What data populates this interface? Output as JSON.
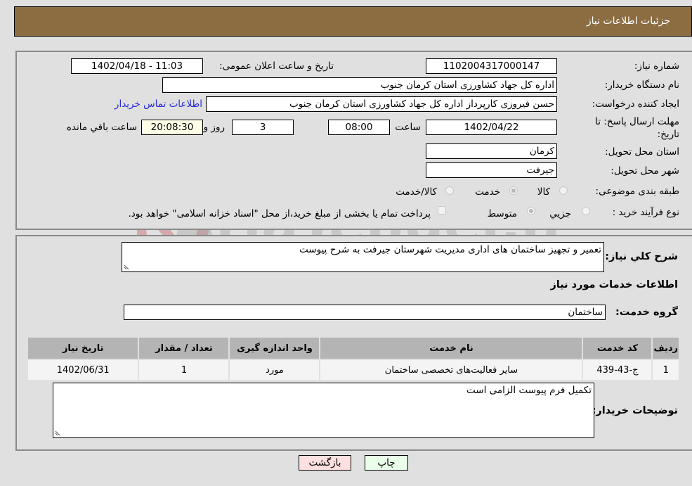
{
  "header": {
    "title": "جزئیات اطلاعات نیاز"
  },
  "details": {
    "need_number_label": "شماره نیاز:",
    "need_number": "1102004317000147",
    "announce_label": "تاریخ و ساعت اعلان عمومی:",
    "announce_value": "1402/04/18 - 11:03",
    "buyer_org_label": "نام دستگاه خریدار:",
    "buyer_org": "اداره کل جهاد کشاورزی استان کرمان   جنوب",
    "creator_label": "ایجاد کننده درخواست:",
    "creator": "حسن فیروزی کارپرداز اداره کل جهاد کشاورزی استان کرمان   جنوب",
    "contact_link": "اطلاعات تماس خریدار",
    "deadline_label_1": "مهلت ارسال پاسخ: تا",
    "deadline_label_2": "تاریخ:",
    "deadline_date": "1402/04/22",
    "time_label": "ساعت",
    "deadline_time": "08:00",
    "days_value": "3",
    "days_label": "روز و",
    "remaining_time": "20:08:30",
    "remaining_label": "ساعت باقي مانده",
    "province_label": "استان محل تحویل:",
    "province": "کرمان",
    "city_label": "شهر محل تحویل:",
    "city": "جیرفت",
    "category_label": "طبقه بندی موضوعی:",
    "category_options": [
      {
        "label": "کالا",
        "selected": false
      },
      {
        "label": "خدمت",
        "selected": true
      },
      {
        "label": "کالا/خدمت",
        "selected": false
      }
    ],
    "process_label": "نوع فرآیند خرید :",
    "process_options": [
      {
        "label": "جزيي",
        "selected": false
      },
      {
        "label": "متوسط",
        "selected": true
      }
    ],
    "treasury_note": "پرداخت تمام یا بخشی از مبلغ خرید،از محل \"اسناد خزانه اسلامی\" خواهد بود.",
    "treasury_checked": false
  },
  "summary": {
    "description_label": "شرح کلي نياز:",
    "description": "تعمیر و تجهیز ساختمان های اداری مدیریت شهرستان جیرفت به شرح پیوست",
    "services_heading": "اطلاعات خدمات مورد نياز",
    "service_group_label": "گروه خدمت:",
    "service_group": "ساختمان"
  },
  "table": {
    "headers": [
      "ردیف",
      "کد خدمت",
      "نام خدمت",
      "واحد اندازه گیری",
      "تعداد / مقدار",
      "تاریخ نیاز"
    ],
    "rows": [
      [
        "1",
        "ج-43-439",
        "سایر فعالیت‌های تخصصی ساختمان",
        "مورد",
        "1",
        "1402/06/31"
      ]
    ]
  },
  "buyer_notes": {
    "label": "توضیحات خریدار:",
    "value": "تکمیل فرم پیوست الزامی است"
  },
  "buttons": {
    "print": "چاپ",
    "back": "بازگشت"
  },
  "watermark": {
    "text": "AriaTender.neT"
  },
  "colors": {
    "header": "#8c6d42",
    "print_bg": "#eaffea",
    "back_bg": "#ffe0e0",
    "link": "#2a2adb"
  }
}
